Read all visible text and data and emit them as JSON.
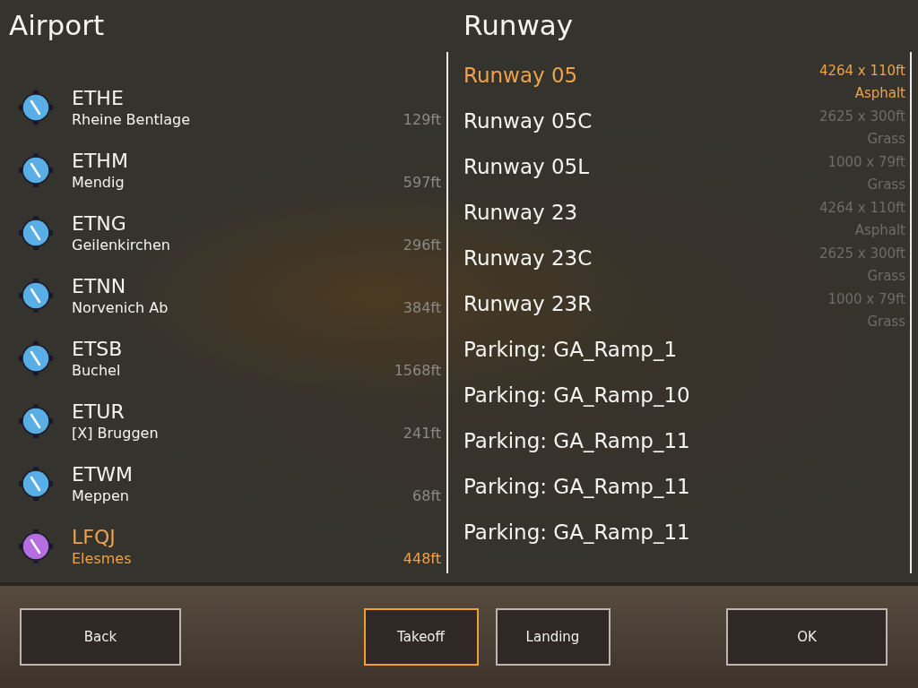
{
  "airport_panel": {
    "title": "Airport",
    "airports": [
      {
        "code": "ETHE",
        "name": "Rheine Bentlage",
        "elevation": "129ft",
        "color": "#5aaee6",
        "selected": false
      },
      {
        "code": "ETHM",
        "name": "Mendig",
        "elevation": "597ft",
        "color": "#5aaee6",
        "selected": false
      },
      {
        "code": "ETNG",
        "name": "Geilenkirchen",
        "elevation": "296ft",
        "color": "#5aaee6",
        "selected": false
      },
      {
        "code": "ETNN",
        "name": "Norvenich Ab",
        "elevation": "384ft",
        "color": "#5aaee6",
        "selected": false
      },
      {
        "code": "ETSB",
        "name": "Buchel",
        "elevation": "1568ft",
        "color": "#5aaee6",
        "selected": false
      },
      {
        "code": "ETUR",
        "name": "[X] Bruggen",
        "elevation": "241ft",
        "color": "#5aaee6",
        "selected": false
      },
      {
        "code": "ETWM",
        "name": "Meppen",
        "elevation": "68ft",
        "color": "#5aaee6",
        "selected": false
      },
      {
        "code": "LFQJ",
        "name": "Elesmes",
        "elevation": "448ft",
        "color": "#b56ee0",
        "selected": true
      }
    ]
  },
  "runway_panel": {
    "title": "Runway",
    "positions": [
      {
        "name": "Runway 05",
        "dimensions": "4264 x 110ft",
        "surface": "Asphalt",
        "selected": true
      },
      {
        "name": "Runway 05C",
        "dimensions": "2625 x 300ft",
        "surface": "Grass",
        "selected": false
      },
      {
        "name": "Runway 05L",
        "dimensions": "1000 x 79ft",
        "surface": "Grass",
        "selected": false
      },
      {
        "name": "Runway 23",
        "dimensions": "4264 x 110ft",
        "surface": "Asphalt",
        "selected": false
      },
      {
        "name": "Runway 23C",
        "dimensions": "2625 x 300ft",
        "surface": "Grass",
        "selected": false
      },
      {
        "name": "Runway 23R",
        "dimensions": "1000 x 79ft",
        "surface": "Grass",
        "selected": false
      },
      {
        "name": "Parking: GA_Ramp_1",
        "selected": false
      },
      {
        "name": "Parking: GA_Ramp_10",
        "selected": false
      },
      {
        "name": "Parking: GA_Ramp_11",
        "selected": false
      },
      {
        "name": "Parking: GA_Ramp_11",
        "selected": false
      },
      {
        "name": "Parking: GA_Ramp_11",
        "selected": false
      }
    ]
  },
  "bottom_bar": {
    "back": "Back",
    "modes": [
      {
        "label": "Takeoff",
        "selected": true
      },
      {
        "label": "Landing",
        "selected": false
      }
    ],
    "ok": "OK"
  }
}
